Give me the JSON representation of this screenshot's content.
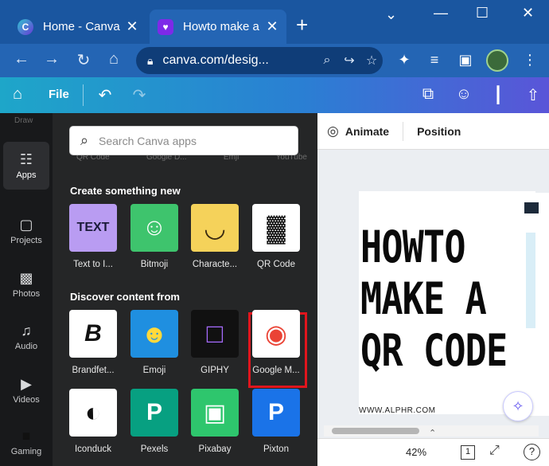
{
  "browser": {
    "tabs": [
      {
        "title": "Home - Canva",
        "favicon": "C"
      },
      {
        "title": "Howto make a",
        "favicon": "♥"
      }
    ],
    "new_tab": "+",
    "window_controls": {
      "dropdown": "⌄",
      "minimize": "—",
      "maximize": "☐",
      "close": "✕"
    },
    "url": "canva.com/desig...",
    "nav": {
      "back": "←",
      "forward": "→",
      "reload": "↻",
      "home": "⌂"
    },
    "omnibox_icons": {
      "zoom": "⌕",
      "share": "↪",
      "bookmark": "☆"
    },
    "toolbar_icons": {
      "extensions": "✦",
      "media": "≡",
      "sidepanel": "▣",
      "menu": "⋮"
    }
  },
  "canva_header": {
    "home_icon": "⌂",
    "file_label": "File",
    "undo": "↶",
    "redo": "↷",
    "right_icons": {
      "resize": "⧉",
      "share_people": "☺",
      "insights": "┃",
      "upload": "⇧"
    }
  },
  "sidebar": {
    "cut_label": "Draw",
    "items": [
      {
        "label": "Apps",
        "icon": "☷"
      },
      {
        "label": "Projects",
        "icon": "▢"
      },
      {
        "label": "Photos",
        "icon": "▩"
      },
      {
        "label": "Audio",
        "icon": "♫"
      },
      {
        "label": "Videos",
        "icon": "▶"
      },
      {
        "label": "Gaming",
        "icon": "■"
      }
    ]
  },
  "apps_panel": {
    "search_placeholder": "Search Canva apps",
    "search_icon": "⌕",
    "cut_row": [
      "QR Code",
      "Google D...",
      "Emji",
      "YouTube"
    ],
    "section1_title": "Create something new",
    "create_apps": [
      {
        "label": "Text to I...",
        "glyph": "TEXT",
        "bg": "#b99cf2",
        "fg": "#1b1b3a"
      },
      {
        "label": "Bitmoji",
        "glyph": "☺",
        "bg": "#3ec46d",
        "fg": "#ffffff"
      },
      {
        "label": "Characte...",
        "glyph": "◡",
        "bg": "#f5d25a",
        "fg": "#3a2a10"
      },
      {
        "label": "QR Code",
        "glyph": "▓",
        "bg": "#ffffff",
        "fg": "#111111"
      }
    ],
    "section2_title": "Discover content from",
    "discover_apps": [
      {
        "label": "Brandfet...",
        "glyph": "B",
        "bg": "#ffffff",
        "fg": "#111111"
      },
      {
        "label": "Emoji",
        "glyph": "☻",
        "bg": "#1f8fe0",
        "fg": "#ffd93b"
      },
      {
        "label": "GIPHY",
        "glyph": "□",
        "bg": "#111111",
        "fg": "#a76bff"
      },
      {
        "label": "Google M...",
        "glyph": "◉",
        "bg": "#ffffff",
        "fg": "#ea4335"
      },
      {
        "label": "Iconduck",
        "glyph": "◐",
        "bg": "#ffffff",
        "fg": "#111111"
      },
      {
        "label": "Pexels",
        "glyph": "P",
        "bg": "#07a081",
        "fg": "#ffffff"
      },
      {
        "label": "Pixabay",
        "glyph": "▣",
        "bg": "#2ec66d",
        "fg": "#ffffff"
      },
      {
        "label": "Pixton",
        "glyph": "P",
        "bg": "#1a73e8",
        "fg": "#ffffff"
      }
    ],
    "collapse_icon": "‹"
  },
  "editor": {
    "animate_label": "Animate",
    "animate_icon": "◎",
    "position_label": "Position",
    "page_text": [
      "HOWTO",
      "MAKE A",
      "QR CODE"
    ],
    "page_footer": "WWW.ALPHR.COM",
    "magic_icon": "✧",
    "chevron_up": "⌃",
    "zoom": "42%",
    "page_count": "1",
    "fullscreen_icon": "⤢",
    "help_label": "?"
  }
}
